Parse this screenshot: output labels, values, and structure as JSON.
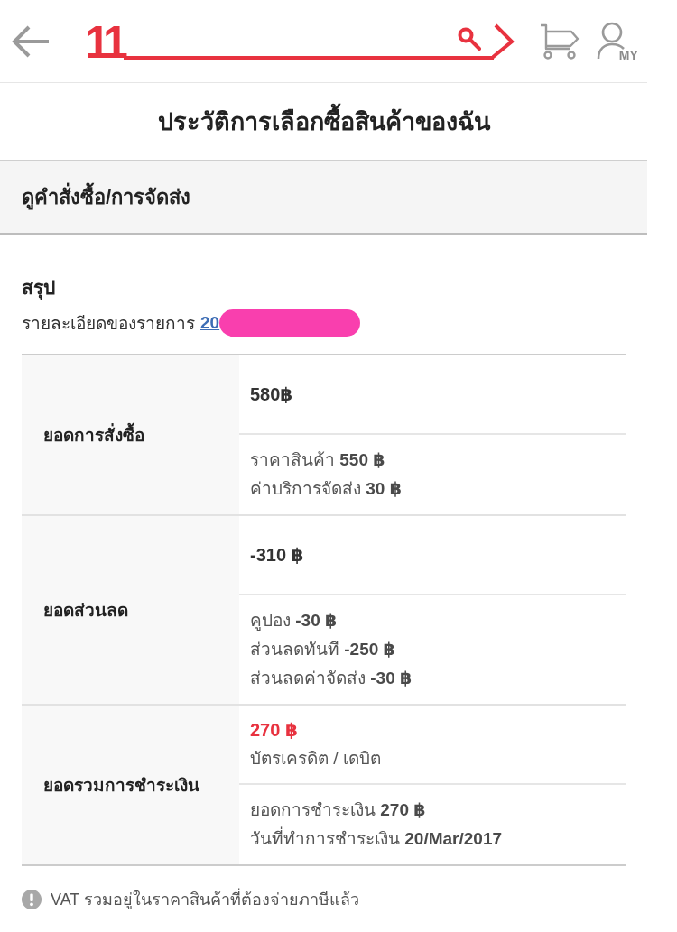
{
  "header": {
    "logo": "11",
    "account_label": "MY"
  },
  "title": "ประวัติการเลือกซื้อสินค้าของฉัน",
  "section_heading": "ดูคำสั่งซื้อ/การจัดส่ง",
  "summary": {
    "heading": "สรุป",
    "order_label": "รายละเอียดของรายการ",
    "order_number": "20",
    "redacted": true
  },
  "payment_table": {
    "rows": [
      {
        "label": "ยอดการสั่งซื้อ",
        "amount": "580฿",
        "highlighted": false,
        "details": [
          "ราคาสินค้า **550 ฿**",
          "ค่าบริการจัดส่ง **30 ฿**"
        ]
      },
      {
        "label": "ยอดส่วนลด",
        "amount": "-310 ฿",
        "highlighted": false,
        "details": [
          "คูปอง **-30 ฿**",
          "ส่วนลดทันที **-250 ฿**",
          "ส่วนลดค่าจัดส่ง **-30 ฿**"
        ]
      },
      {
        "label": "ยอดรวมการชำระเงิน",
        "amount": "270 ฿",
        "highlighted": true,
        "method": "บัตรเครดิต / เดบิต",
        "details": [
          "ยอดการชำระเงิน **270 ฿**",
          "วันที่ทำการชำระเงิน **20/Mar/2017**"
        ]
      }
    ]
  },
  "note": "VAT รวมอยู่ในราคาสินค้าที่ต้องจ่ายภาษีแล้ว"
}
